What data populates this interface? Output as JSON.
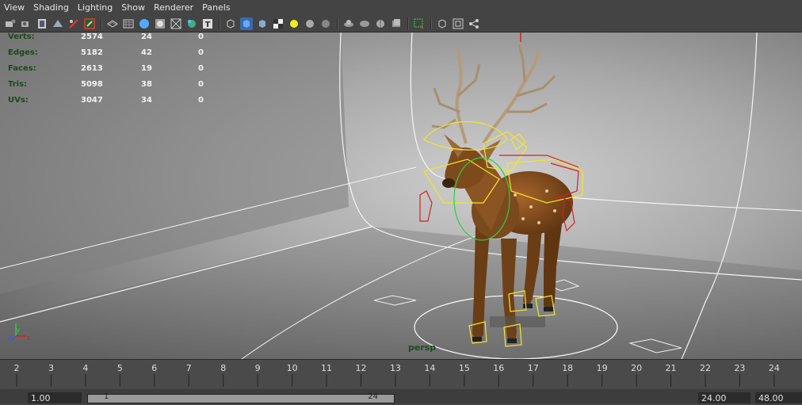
{
  "menu": [
    "View",
    "Shading",
    "Lighting",
    "Show",
    "Renderer",
    "Panels"
  ],
  "toolbar_icons": [
    "select-camera-icon",
    "camera-attributes-icon",
    "bookmark-icon",
    "image-plane-icon",
    "grid-toggle-icon",
    "film-gate-icon",
    "resolution-gate-icon",
    "safe-action-icon",
    "wireframe-icon",
    "smooth-shade-icon",
    "default-material-icon",
    "x-ray-icon",
    "joint-xray-icon",
    "texture-icon",
    "use-lights-icon",
    "shadows-icon",
    "ambient-occlusion-icon",
    "motion-blur-icon",
    "multisample-icon",
    "depth-of-field-icon",
    "isolate-select-icon",
    "camera-grid-icon",
    "panel-layout-icon",
    "share-icon"
  ],
  "hud": {
    "rows": [
      {
        "label": "Verts:",
        "c1": "2574",
        "c2": "24",
        "c3": "0"
      },
      {
        "label": "Edges:",
        "c1": "5182",
        "c2": "42",
        "c3": "0"
      },
      {
        "label": "Faces:",
        "c1": "2613",
        "c2": "19",
        "c3": "0"
      },
      {
        "label": "Tris:",
        "c1": "5098",
        "c2": "38",
        "c3": "0"
      },
      {
        "label": "UVs:",
        "c1": "3047",
        "c2": "34",
        "c3": "0"
      }
    ]
  },
  "camera_label": "persp",
  "axis": {
    "x": "x",
    "y": "y",
    "z": "z"
  },
  "timeline": {
    "ticks": [
      "2",
      "3",
      "4",
      "5",
      "6",
      "7",
      "8",
      "9",
      "10",
      "11",
      "12",
      "13",
      "14",
      "15",
      "16",
      "17",
      "18",
      "19",
      "20",
      "21",
      "22",
      "23",
      "24"
    ]
  },
  "range": {
    "start_field": "1.00",
    "slider_start": "1",
    "slider_end": "24",
    "end_field": "24.00",
    "anim_end_field": "48.00"
  },
  "colors": {
    "background": "#444444",
    "hud_label": "#1a4a1a",
    "rig_yellow": "#f5e52a",
    "rig_red": "#d42020",
    "rig_green": "#2ecc40"
  }
}
